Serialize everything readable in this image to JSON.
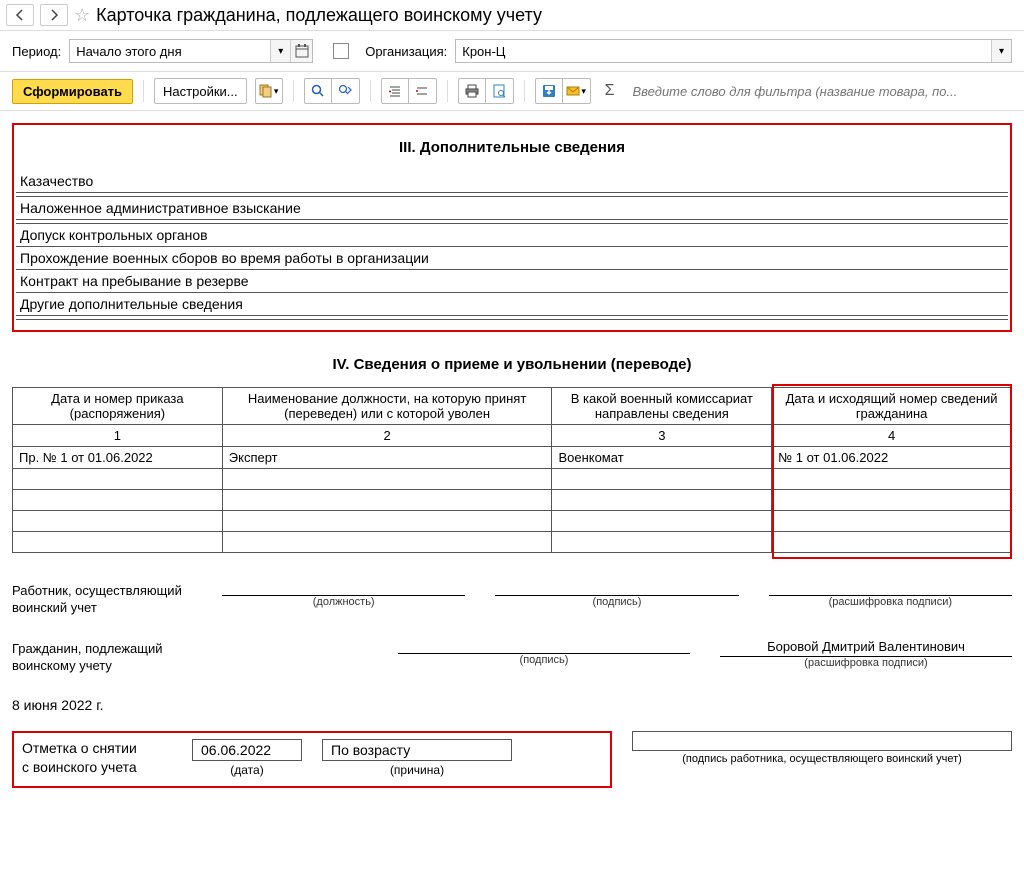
{
  "header": {
    "title": "Карточка гражданина, подлежащего воинскому учету"
  },
  "controls": {
    "period_label": "Период:",
    "period_value": "Начало этого дня",
    "org_label": "Организация:",
    "org_value": "Крон-Ц"
  },
  "toolbar": {
    "generate": "Сформировать",
    "settings": "Настройки...",
    "filter_placeholder": "Введите слово для фильтра (название товара, по..."
  },
  "section3": {
    "title": "III. Дополнительные сведения",
    "rows": [
      "Казачество",
      "Наложенное административное взыскание",
      "Допуск контрольных органов",
      "Прохождение военных сборов во время работы в организации",
      "Контракт на пребывание в резерве",
      "Другие дополнительные сведения"
    ]
  },
  "section4": {
    "title": "IV. Сведения о приеме и увольнении (переводе)",
    "headers": [
      "Дата и номер приказа (распоряжения)",
      "Наименование должности, на которую принят (переведен) или с которой уволен",
      "В какой военный комиссариат направлены сведения",
      "Дата и исходящий номер сведений гражданина"
    ],
    "colnums": [
      "1",
      "2",
      "3",
      "4"
    ],
    "row1": {
      "c1": "Пр. № 1 от 01.06.2022",
      "c2": "Эксперт",
      "c3": "Военкомат",
      "c4": "№ 1 от 01.06.2022"
    }
  },
  "signatures": {
    "worker_label": "Работник, осуществляющий воинский учет",
    "citizen_label": "Гражданин, подлежащий воинскому учету",
    "cap_position": "(должность)",
    "cap_sign": "(подпись)",
    "cap_name": "(расшифровка подписи)",
    "citizen_name": "Боровой Дмитрий Валентинович",
    "date_text": "8 июня 2022 г."
  },
  "removal": {
    "label1": "Отметка о снятии",
    "label2": "с воинского учета",
    "date": "06.06.2022",
    "date_cap": "(дата)",
    "reason": "По возрасту",
    "reason_cap": "(причина)",
    "sig_cap": "(подпись работника, осуществляющего воинский учет)"
  }
}
